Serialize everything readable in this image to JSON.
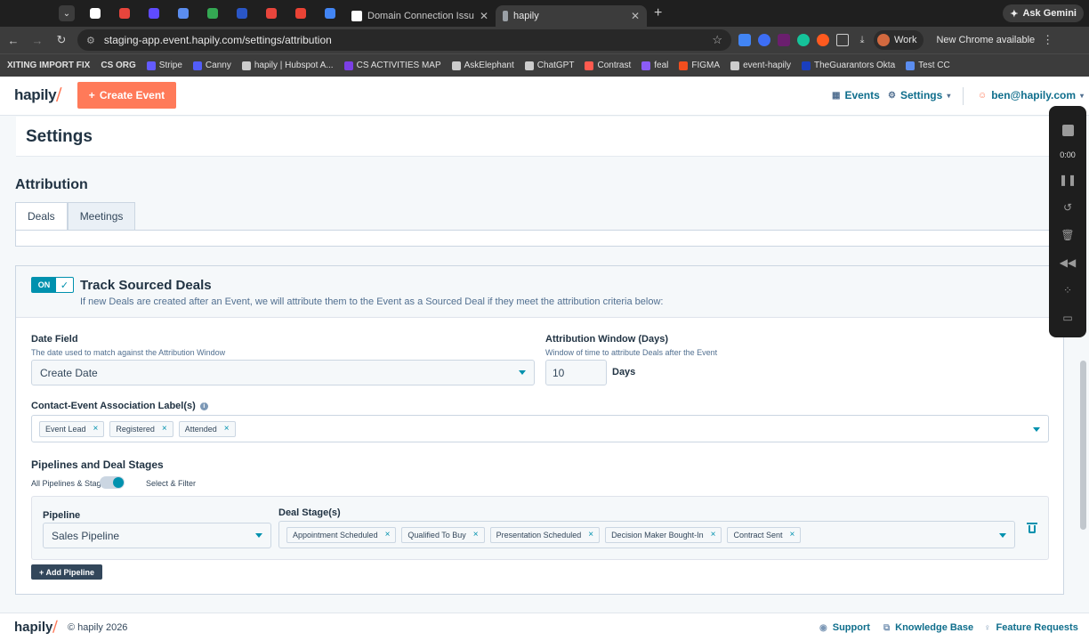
{
  "browser": {
    "tabs": [
      {
        "title": "Domain Connection Issues | F",
        "favicon_color": "#ffffff"
      },
      {
        "title": "hapily",
        "favicon_color": "#9aa0a6"
      }
    ],
    "pinned_tab_colors": [
      "#ffffff",
      "#e8453c",
      "#5f4bff",
      "#5b8def",
      "#34a853",
      "#2a56c6",
      "#e8453c",
      "#ea4335",
      "#4285f4"
    ],
    "ask_gemini": "Ask Gemini",
    "url": "staging-app.event.hapily.com/settings/attribution",
    "profile_label": "Work",
    "update_label": "New Chrome available",
    "bookmarks": [
      {
        "label": "XITING IMPORT FIX",
        "bold": true,
        "color": ""
      },
      {
        "label": "CS ORG",
        "bold": true,
        "color": ""
      },
      {
        "label": "Stripe",
        "bold": false,
        "color": "#635bff"
      },
      {
        "label": "Canny",
        "bold": false,
        "color": "#525df9"
      },
      {
        "label": "hapily | Hubspot A...",
        "bold": false,
        "color": "#cccccc"
      },
      {
        "label": "CS ACTIVITIES MAP",
        "bold": false,
        "color": "#7b3fe4"
      },
      {
        "label": "AskElephant",
        "bold": false,
        "color": "#cccccc"
      },
      {
        "label": "ChatGPT",
        "bold": false,
        "color": "#cccccc"
      },
      {
        "label": "Contrast",
        "bold": false,
        "color": "#ff5a4f"
      },
      {
        "label": "feal",
        "bold": false,
        "color": "#8b5cf6"
      },
      {
        "label": "FIGMA",
        "bold": false,
        "color": "#f24e1e"
      },
      {
        "label": "event-hapily",
        "bold": false,
        "color": "#cccccc"
      },
      {
        "label": "TheGuarantors Okta",
        "bold": false,
        "color": "#1a3fbf"
      },
      {
        "label": "Test CC",
        "bold": false,
        "color": "#5b8def"
      }
    ]
  },
  "header": {
    "logo": "hapily",
    "create_event": "Create Event",
    "events": "Events",
    "settings": "Settings",
    "user": "ben@hapily.com"
  },
  "page": {
    "title": "Settings",
    "section": "Attribution",
    "tabs": [
      "Deals",
      "Meetings"
    ]
  },
  "card": {
    "toggle_state": "ON",
    "title": "Track Sourced Deals",
    "subtitle": "If new Deals are created after an Event, we will attribute them to the Event as a Sourced Deal if they meet the attribution criteria below:",
    "date_field": {
      "label": "Date Field",
      "help": "The date used to match against the Attribution Window",
      "value": "Create Date"
    },
    "attribution_window": {
      "label": "Attribution Window (Days)",
      "help": "Window of time to attribute Deals after the Event",
      "value": "10",
      "unit": "Days"
    },
    "association": {
      "label": "Contact-Event Association Label(s)",
      "chips": [
        "Event Lead",
        "Registered",
        "Attended"
      ]
    },
    "pipelines": {
      "label": "Pipelines and Deal Stages",
      "toggle_left": "All Pipelines & Stages",
      "toggle_right": "Select & Filter",
      "pipeline_label": "Pipeline",
      "pipeline_value": "Sales Pipeline",
      "stages_label": "Deal Stage(s)",
      "stages": [
        "Appointment Scheduled",
        "Qualified To Buy",
        "Presentation Scheduled",
        "Decision Maker Bought-In",
        "Contract Sent"
      ],
      "add_button": "+ Add Pipeline"
    }
  },
  "recorder": {
    "time": "0:00"
  },
  "footer": {
    "logo": "hapily",
    "copyright": "© hapily 2026",
    "support": "Support",
    "knowledge_base": "Knowledge Base",
    "feature_requests": "Feature Requests"
  },
  "colors": {
    "accent": "#ff7a59",
    "link": "#0f6e8c",
    "primary": "#0091ae"
  }
}
